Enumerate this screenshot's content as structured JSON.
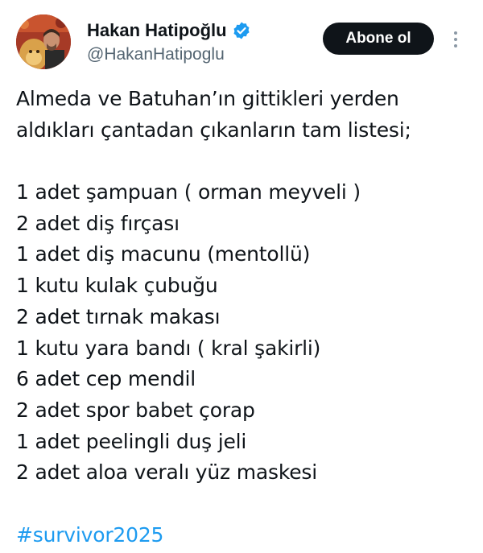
{
  "author": {
    "display_name": "Hakan Hatipoğlu",
    "handle": "@HakanHatipoglu",
    "verified_icon": "verified-badge-icon",
    "verified_color": "#1d9bf0"
  },
  "actions": {
    "follow_label": "Abone ol",
    "more_icon": "more-vertical-icon"
  },
  "tweet": {
    "intro_lines": [
      "Almeda ve Batuhan’ın gittikleri yerden",
      "aldıkları çantadan çıkanların tam listesi;"
    ],
    "items": [
      "1 adet şampuan ( orman meyveli )",
      "2 adet diş fırçası",
      "1 adet diş macunu (mentollü)",
      "1 kutu kulak çubuğu",
      "2 adet tırnak makası",
      "1 kutu yara bandı ( kral şakirli)",
      "6 adet cep mendil",
      "2 adet spor babet çorap",
      "1 adet peelingli duş jeli",
      "2 adet aloa veralı yüz maskesi"
    ],
    "hashtag": "#survivor2025"
  },
  "colors": {
    "text": "#0f1419",
    "secondary": "#536471",
    "link": "#1d9bf0",
    "button_bg": "#0f1419"
  }
}
